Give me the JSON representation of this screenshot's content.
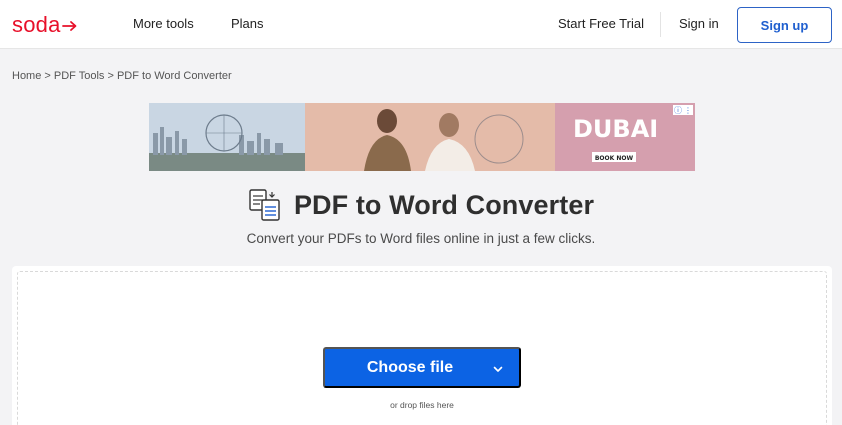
{
  "header": {
    "logo_text": "soda",
    "nav": {
      "more_tools": "More tools",
      "plans": "Plans",
      "start_free_trial": "Start Free Trial",
      "sign_in": "Sign in",
      "sign_up": "Sign up"
    }
  },
  "breadcrumb": {
    "text": "Home > PDF Tools > PDF to Word Converter"
  },
  "ad": {
    "headline": "DUBAI",
    "cta": "BOOK NOW"
  },
  "main": {
    "title": "PDF to Word Converter",
    "subtitle": "Convert your PDFs to Word files online in just a few clicks.",
    "choose_file": "Choose file",
    "drop_hint": "or drop files here"
  },
  "colors": {
    "brand_red": "#e8102a",
    "primary_blue": "#0c63e4",
    "signup_border": "#2d63c6"
  }
}
